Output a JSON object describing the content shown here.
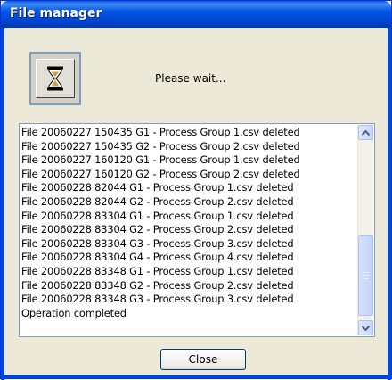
{
  "window": {
    "title": "File manager"
  },
  "status": {
    "message": "Please wait..."
  },
  "log": {
    "lines": [
      "File 20060227 150435 G1 - Process Group 1.csv deleted",
      "File 20060227 150435 G2 - Process Group 2.csv deleted",
      "File 20060227 160120 G1 - Process Group 1.csv deleted",
      "File 20060227 160120 G2 - Process Group 2.csv deleted",
      "File 20060228  82044 G1 - Process Group 1.csv deleted",
      "File 20060228  82044 G2 - Process Group 2.csv deleted",
      "File 20060228  83304 G1 - Process Group 1.csv deleted",
      "File 20060228  83304 G2 - Process Group 2.csv deleted",
      "File 20060228  83304 G3 - Process Group 3.csv deleted",
      "File 20060228  83304 G4 - Process Group 4.csv deleted",
      "File 20060228  83348 G1 - Process Group 1.csv deleted",
      "File 20060228  83348 G2 - Process Group 2.csv deleted",
      "File 20060228  83348 G3 - Process Group 3.csv deleted",
      "Operation completed"
    ]
  },
  "buttons": {
    "close_label": "Close"
  },
  "icons": {
    "status_icon": "hourglass-icon",
    "scroll_up": "arrow-up-icon",
    "scroll_down": "arrow-down-icon"
  },
  "colors": {
    "titlebar": "#0055e5",
    "dialog_bg": "#ece9d8",
    "border": "#7f9db9"
  }
}
